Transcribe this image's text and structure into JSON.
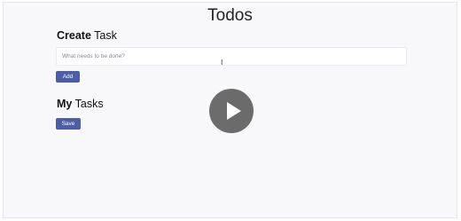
{
  "app": {
    "title": "Todos"
  },
  "create_section": {
    "heading_bold": "Create",
    "heading_rest": " Task",
    "input_placeholder": "What needs to be done?",
    "input_value": "",
    "add_label": "Add"
  },
  "tasks_section": {
    "heading_bold": "My",
    "heading_rest": " Tasks",
    "save_label": "Save",
    "tasks": []
  },
  "overlay": {
    "icon": "play-icon",
    "color": "#646464"
  },
  "colors": {
    "accent": "#4b5fa8",
    "background": "#f8f8fb"
  }
}
